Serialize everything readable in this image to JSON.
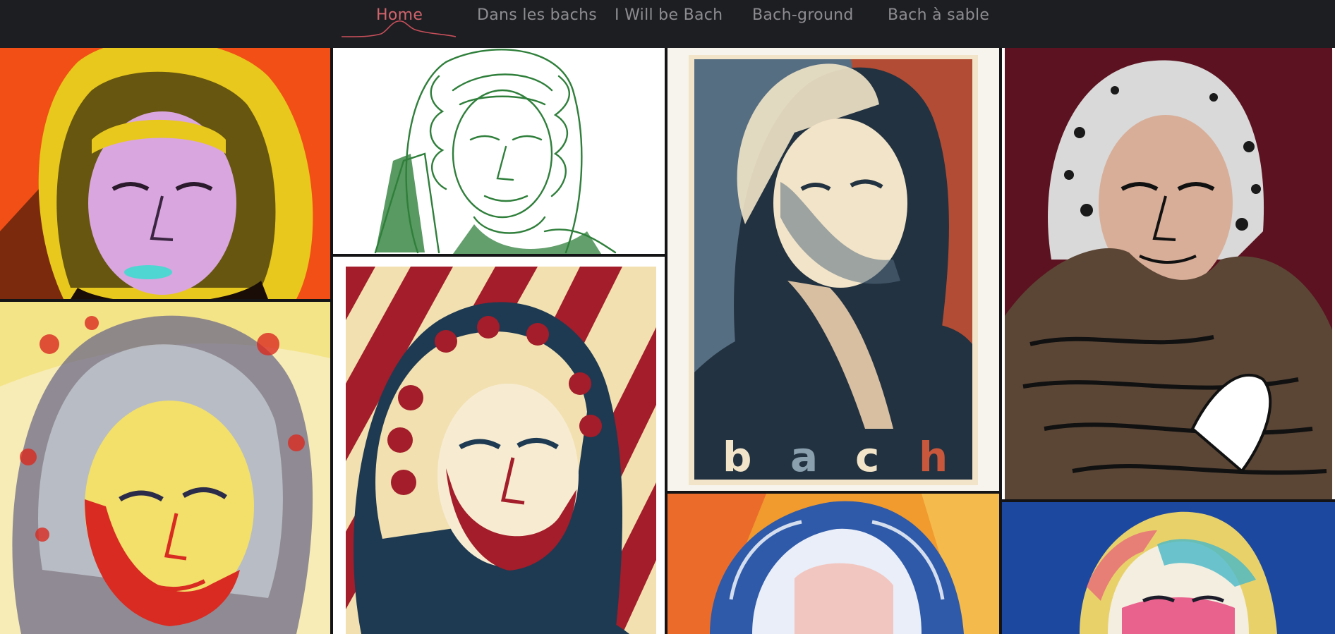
{
  "nav": {
    "items": [
      {
        "label": "Home",
        "active": true
      },
      {
        "label": "Dans les bachs",
        "active": false
      },
      {
        "label": "I Will be Bach",
        "active": false
      },
      {
        "label": "Bach-ground",
        "active": false
      },
      {
        "label": "Bach à sable",
        "active": false
      }
    ],
    "active_color": "#d0646c",
    "inactive_color": "#8d8d91",
    "background": "#1d1e22"
  },
  "gallery": {
    "tiles": [
      {
        "name": "bach-pop-art-orange",
        "palette": [
          "#f24f16",
          "#e8c81c",
          "#d9a6df",
          "#4fd6d3"
        ]
      },
      {
        "name": "bach-green-line-sketch",
        "palette": [
          "#ffffff",
          "#2f7f3b"
        ]
      },
      {
        "name": "bach-hope-poster",
        "palette": [
          "#f2e4c8",
          "#566e82",
          "#223240",
          "#b24c34"
        ],
        "caption_letters": [
          "b",
          "a",
          "c",
          "h"
        ]
      },
      {
        "name": "bach-monk-comic",
        "palette": [
          "#5c1220",
          "#d9d9d9",
          "#d8ae98",
          "#5b4636"
        ]
      },
      {
        "name": "bach-grunge-pop",
        "palette": [
          "#f7ecb5",
          "#d92b21",
          "#6e6a8a",
          "#f2e06a"
        ]
      },
      {
        "name": "bach-striped-poster",
        "palette": [
          "#f2e0b0",
          "#a31d2a",
          "#1e3a52"
        ]
      },
      {
        "name": "bach-blue-oil-painting",
        "palette": [
          "#f19a2e",
          "#2e5aa9",
          "#e9eef8"
        ]
      },
      {
        "name": "bach-rainbow-watercolor",
        "palette": [
          "#1c48a0",
          "#e9d16a",
          "#e6487e",
          "#47b8c7"
        ]
      }
    ]
  }
}
